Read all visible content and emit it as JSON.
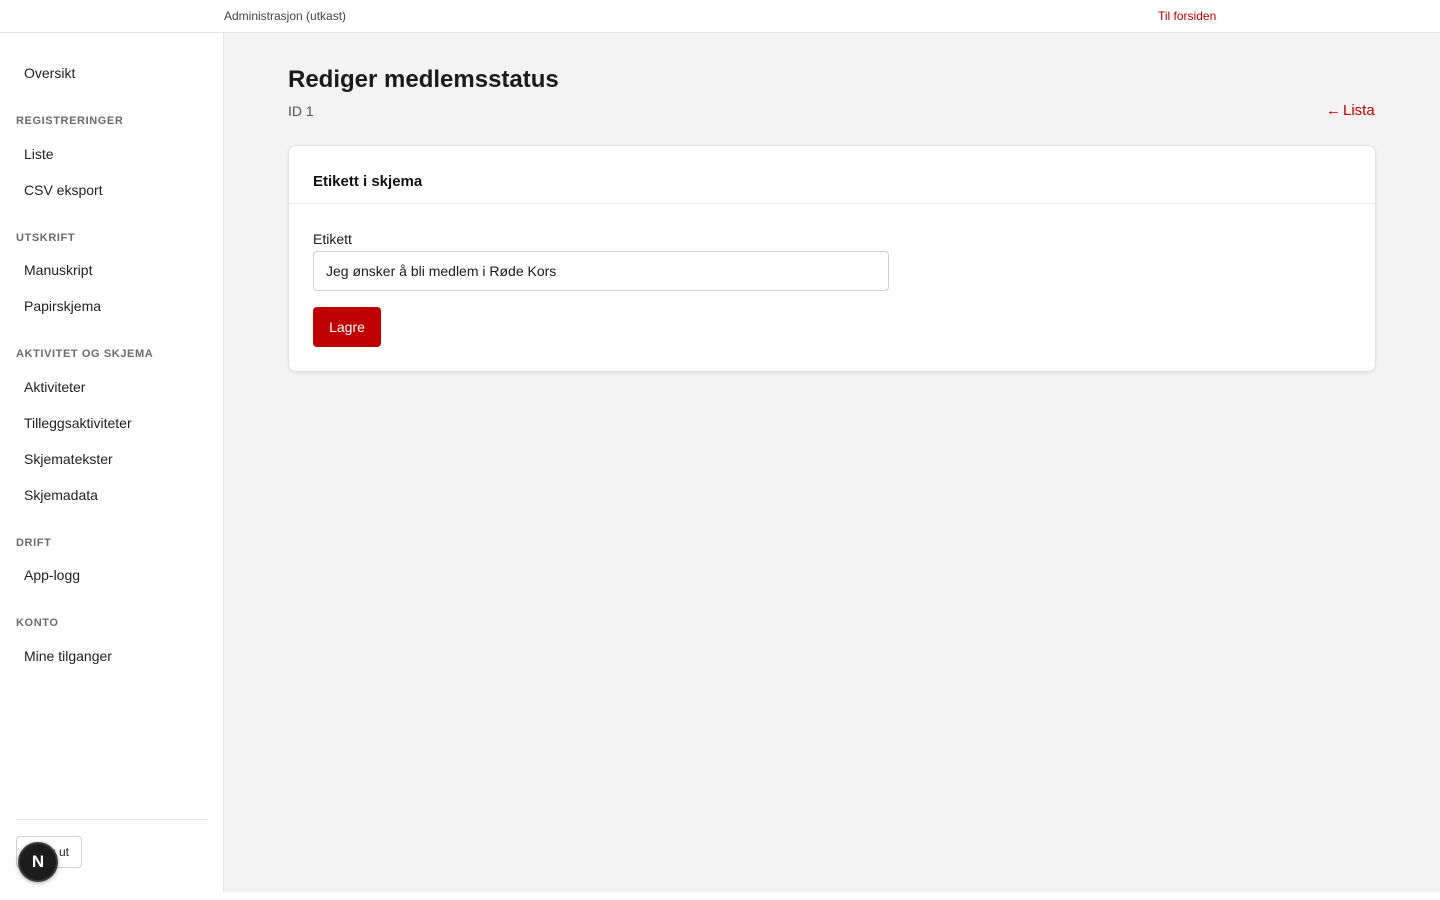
{
  "header": {
    "app_title": "Administrasjon (utkast)",
    "home_link": "Til forsiden"
  },
  "sidebar": {
    "overview": "Oversikt",
    "sections": [
      {
        "title": "REGISTRERINGER",
        "items": [
          "Liste",
          "CSV eksport"
        ]
      },
      {
        "title": "UTSKRIFT",
        "items": [
          "Manuskript",
          "Papirskjema"
        ]
      },
      {
        "title": "AKTIVITET OG SKJEMA",
        "items": [
          "Aktiviteter",
          "Tilleggsaktiviteter",
          "Skjematekster",
          "Skjemadata"
        ]
      },
      {
        "title": "DRIFT",
        "items": [
          "App-logg"
        ]
      },
      {
        "title": "KONTO",
        "items": [
          "Mine tilganger"
        ]
      }
    ],
    "logout_label": "Logg ut",
    "dev_badge_letter": "N"
  },
  "main": {
    "title": "Rediger medlemsstatus",
    "record_id": "ID 1",
    "back_arrow": "←",
    "back_label": "Lista",
    "card": {
      "title": "Etikett i skjema",
      "field_label": "Etikett",
      "field_value": "Jeg ønsker å bli medlem i Røde Kors",
      "save_label": "Lagre"
    }
  },
  "colors": {
    "accent": "#c00000",
    "background": "#f3f3f3",
    "surface": "#ffffff"
  }
}
